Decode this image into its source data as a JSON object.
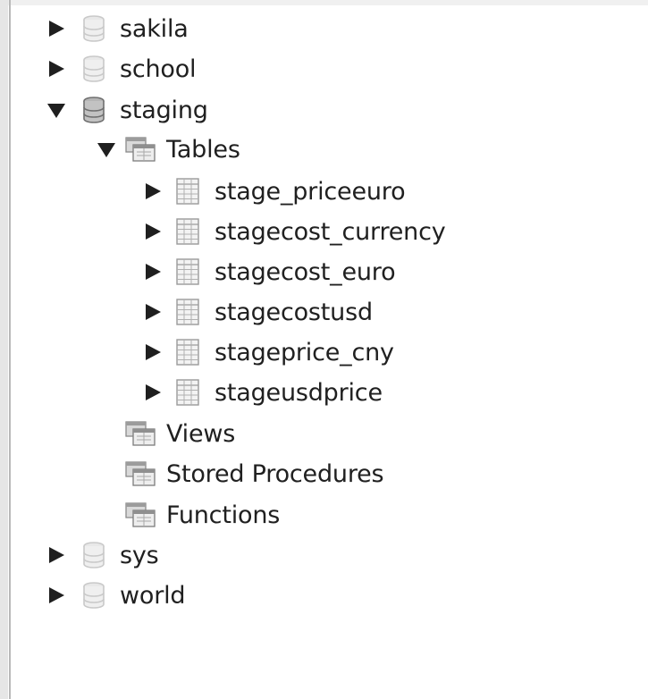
{
  "schema_tree": {
    "databases": [
      {
        "name": "sakila",
        "expanded": false
      },
      {
        "name": "school",
        "expanded": false
      },
      {
        "name": "staging",
        "expanded": true,
        "groups": [
          {
            "name": "Tables",
            "expanded": true,
            "items": [
              "stage_priceeuro",
              "stagecost_currency",
              "stagecost_euro",
              "stagecostusd",
              "stageprice_cny",
              "stageusdprice"
            ]
          },
          {
            "name": "Views",
            "expanded": false
          },
          {
            "name": "Stored Procedures",
            "expanded": false
          },
          {
            "name": "Functions",
            "expanded": false
          }
        ]
      },
      {
        "name": "sys",
        "expanded": false
      },
      {
        "name": "world",
        "expanded": false
      }
    ]
  },
  "icons": {
    "arrow_collapsed": "triangle-right-icon",
    "arrow_expanded": "triangle-down-icon",
    "database": "database-icon",
    "folder_group": "folder-group-icon",
    "table": "table-icon"
  },
  "colors": {
    "arrow": "#1f1f1f",
    "db_icon_inactive": "#cfcfcf",
    "db_icon_active": "#7a7a7a",
    "text": "#202020"
  }
}
